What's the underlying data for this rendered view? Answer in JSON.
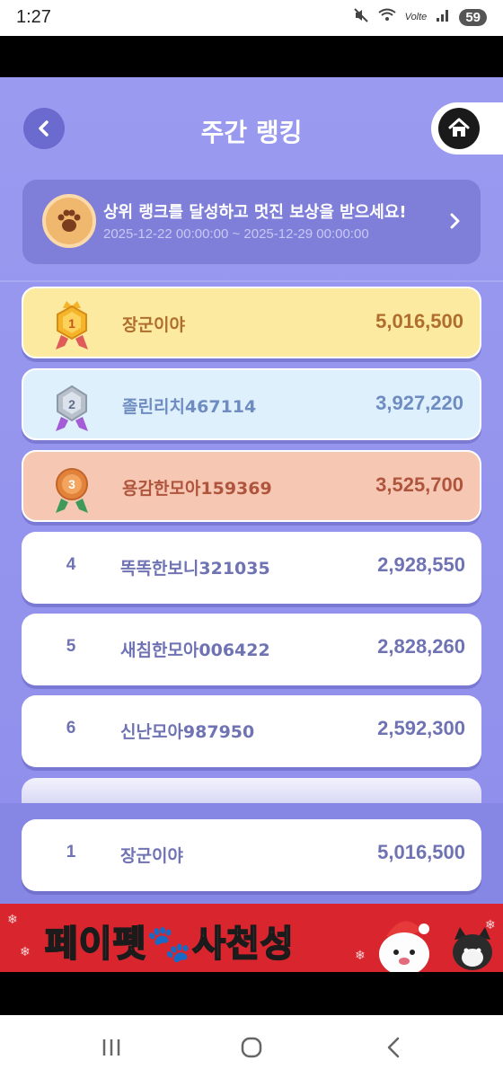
{
  "status_bar": {
    "time": "1:27",
    "network": "Volte",
    "battery": "59"
  },
  "header": {
    "title": "주간 랭킹",
    "back_icon": "chevron-left-icon",
    "home_icon": "home-icon"
  },
  "banner": {
    "icon": "paw-icon",
    "message": "상위 랭크를 달성하고 멋진 보상을 받으세요!",
    "period": "2025-12-22 00:00:00 ~ 2025-12-29 00:00:00"
  },
  "ranking": [
    {
      "rank": "1",
      "name": "장군이야",
      "score": "5,016,500",
      "tier": "gold"
    },
    {
      "rank": "2",
      "name": "졸린리치467114",
      "score": "3,927,220",
      "tier": "silver"
    },
    {
      "rank": "3",
      "name": "용감한모아159369",
      "score": "3,525,700",
      "tier": "bronze"
    },
    {
      "rank": "4",
      "name": "똑똑한보니321035",
      "score": "2,928,550",
      "tier": "plain"
    },
    {
      "rank": "5",
      "name": "새침한모아006422",
      "score": "2,828,260",
      "tier": "plain"
    },
    {
      "rank": "6",
      "name": "신난모아987950",
      "score": "2,592,300",
      "tier": "plain"
    }
  ],
  "my_rank": {
    "rank": "1",
    "name": "장군이야",
    "score": "5,016,500"
  },
  "ad": {
    "text": "페이펫🐾사천성"
  },
  "colors": {
    "background": "#9a9af0",
    "gold": "#fbeaa0",
    "silver": "#dff0fd",
    "bronze": "#f6c8b4",
    "accent_text": "#6f73b3"
  }
}
